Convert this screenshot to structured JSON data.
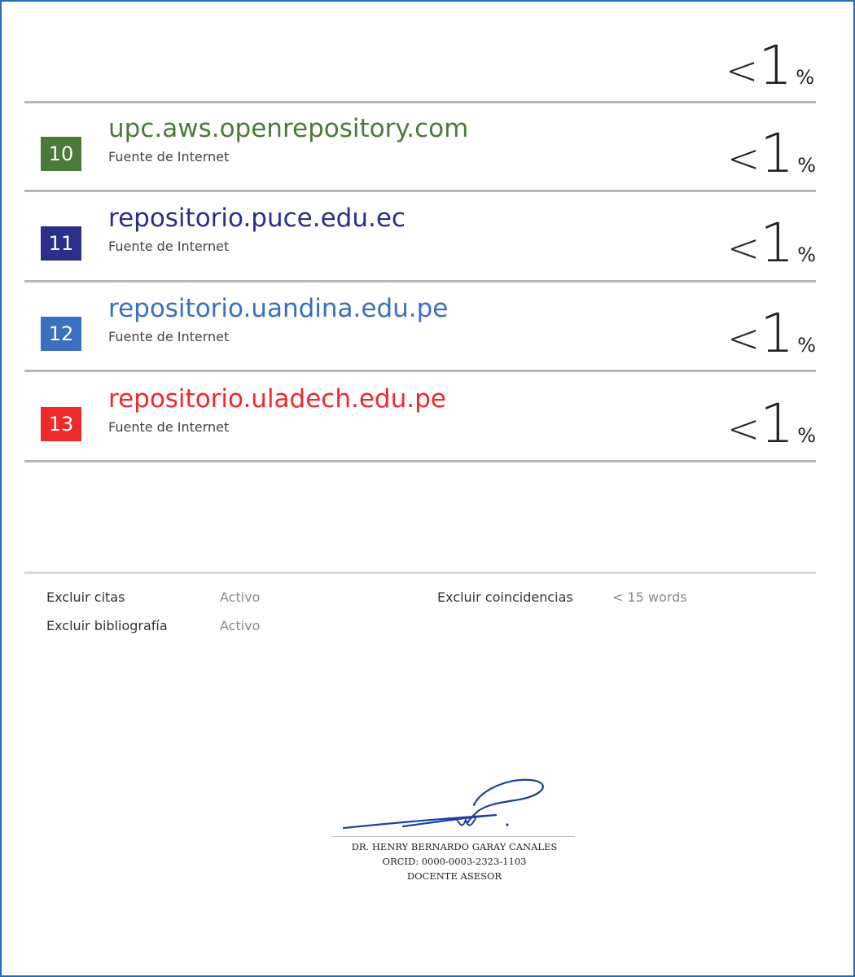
{
  "top_match": {
    "lt": "<",
    "num": "1",
    "sign": "%"
  },
  "sources": [
    {
      "rank": "10",
      "title": "upc.aws.openrepository.com",
      "subtitle": "Fuente de Internet",
      "lt": "<",
      "num": "1",
      "sign": "%",
      "color": "#4b7a3a"
    },
    {
      "rank": "11",
      "title": "repositorio.puce.edu.ec",
      "subtitle": "Fuente de Internet",
      "lt": "<",
      "num": "1",
      "sign": "%",
      "color": "#2b2e8a"
    },
    {
      "rank": "12",
      "title": "repositorio.uandina.edu.pe",
      "subtitle": "Fuente de Internet",
      "lt": "<",
      "num": "1",
      "sign": "%",
      "color": "#3b6fbf"
    },
    {
      "rank": "13",
      "title": "repositorio.uladech.edu.pe",
      "subtitle": "Fuente de Internet",
      "lt": "<",
      "num": "1",
      "sign": "%",
      "color": "#ee2a2a"
    }
  ],
  "options": {
    "exclude_quotes_label": "Excluir citas",
    "exclude_quotes_value": "Activo",
    "exclude_biblio_label": "Excluir bibliografía",
    "exclude_biblio_value": "Activo",
    "exclude_matches_label": "Excluir coincidencias",
    "exclude_matches_value": "< 15 words"
  },
  "signature": {
    "name": "DR. HENRY BERNARDO GARAY CANALES",
    "orcid": "ORCID: 0000-0003-2323-1103",
    "role": "DOCENTE ASESOR"
  },
  "colors": {
    "frame_border": "#1e6fb8",
    "signature_ink": "#1f3fa0"
  }
}
